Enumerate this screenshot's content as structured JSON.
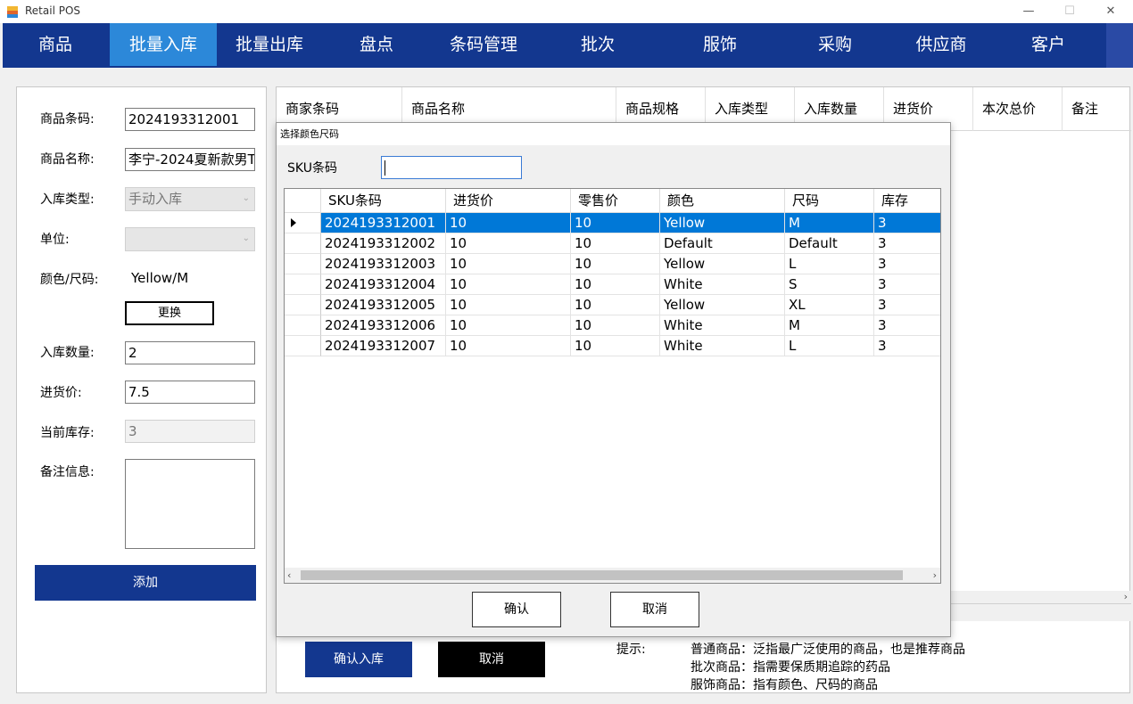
{
  "window": {
    "title": "Retail POS"
  },
  "nav": {
    "items": [
      "商品",
      "批量入库",
      "批量出库",
      "盘点",
      "条码管理",
      "批次",
      "服饰",
      "采购",
      "供应商",
      "客户"
    ],
    "active": "批量入库"
  },
  "form": {
    "barcode_label": "商品条码:",
    "barcode_value": "2024193312001",
    "name_label": "商品名称:",
    "name_value": "李宁-2024夏新款男T",
    "type_label": "入库类型:",
    "type_value": "手动入库",
    "unit_label": "单位:",
    "unit_value": "",
    "color_size_label": "颜色/尺码:",
    "color_size_value": "Yellow/M",
    "change_button": "更换",
    "qty_label": "入库数量:",
    "qty_value": "2",
    "price_label": "进货价:",
    "price_value": "7.5",
    "stock_label": "当前库存:",
    "stock_value": "3",
    "memo_label": "备注信息:",
    "add_button": "添加"
  },
  "main_grid": {
    "columns": [
      "商家条码",
      "商品名称",
      "商品规格",
      "入库类型",
      "入库数量",
      "进货价",
      "本次总价",
      "备注"
    ]
  },
  "bottom": {
    "confirm_button": "确认入库",
    "cancel_button": "取消",
    "tip_label": "提示:",
    "tips": [
      "普通商品：泛指最广泛使用的商品，也是推荐商品",
      "批次商品：指需要保质期追踪的药品",
      "服饰商品：指有颜色、尺码的商品"
    ]
  },
  "dialog": {
    "title": "选择颜色尺码",
    "sku_label": "SKU条码",
    "sku_input_value": "",
    "columns": [
      "SKU条码",
      "进货价",
      "零售价",
      "颜色",
      "尺码",
      "库存"
    ],
    "rows": [
      [
        "2024193312001",
        "10",
        "10",
        "Yellow",
        "M",
        "3"
      ],
      [
        "2024193312002",
        "10",
        "10",
        "Default",
        "Default",
        "3"
      ],
      [
        "2024193312003",
        "10",
        "10",
        "Yellow",
        "L",
        "3"
      ],
      [
        "2024193312004",
        "10",
        "10",
        "White",
        "S",
        "3"
      ],
      [
        "2024193312005",
        "10",
        "10",
        "Yellow",
        "XL",
        "3"
      ],
      [
        "2024193312006",
        "10",
        "10",
        "White",
        "M",
        "3"
      ],
      [
        "2024193312007",
        "10",
        "10",
        "White",
        "L",
        "3"
      ]
    ],
    "selected_row": 0,
    "confirm_button": "确认",
    "cancel_button": "取消"
  },
  "colors": {
    "nav_bg": "#13378f",
    "nav_active": "#2c88d9",
    "selection": "#0078d7",
    "primary_button": "#13378f",
    "cancel_button": "#000000"
  }
}
